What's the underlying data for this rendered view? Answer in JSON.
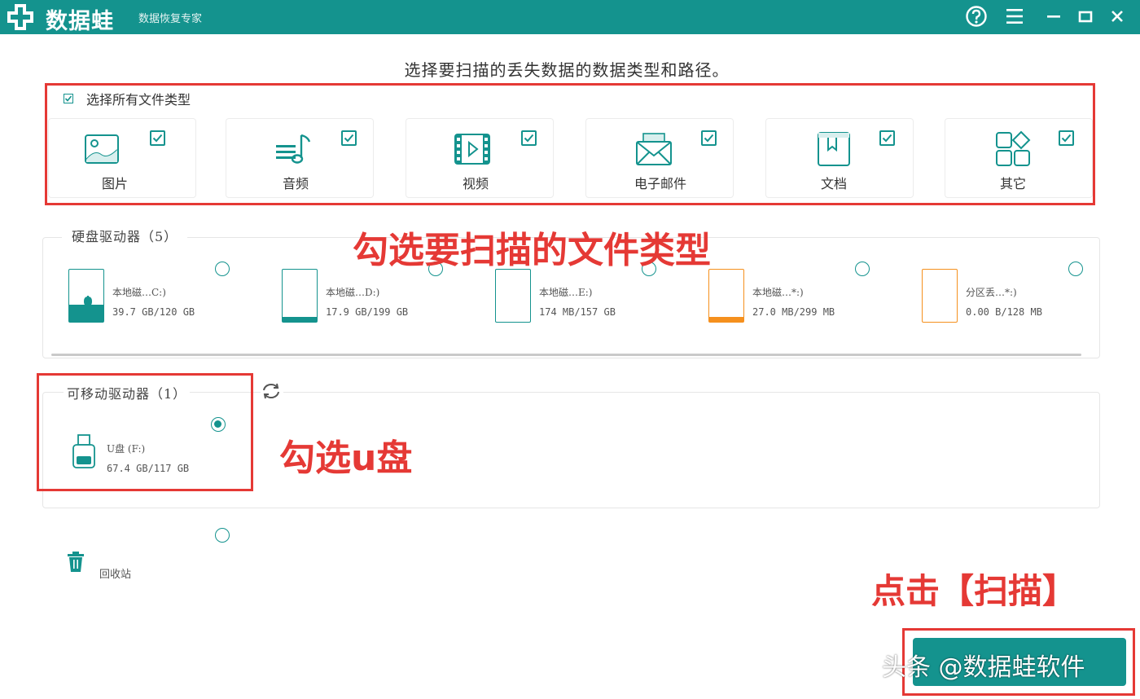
{
  "titlebar": {
    "app_name": "数据蛙",
    "subtitle": "数据恢复专家",
    "background": "#14938e"
  },
  "instruction": "选择要扫描的丢失数据的数据类型和路径。",
  "file_types": {
    "select_all_label": "选择所有文件类型",
    "select_all_checked": true,
    "items": [
      {
        "label": "图片",
        "icon": "image-icon",
        "checked": true
      },
      {
        "label": "音频",
        "icon": "music-icon",
        "checked": true
      },
      {
        "label": "视频",
        "icon": "video-icon",
        "checked": true
      },
      {
        "label": "电子邮件",
        "icon": "email-icon",
        "checked": true
      },
      {
        "label": "文档",
        "icon": "document-icon",
        "checked": true
      },
      {
        "label": "其它",
        "icon": "other-icon",
        "checked": true
      }
    ]
  },
  "hard_drives": {
    "legend": "硬盘驱动器（5）",
    "items": [
      {
        "name": "本地磁…C:)",
        "size": "39.7 GB/120 GB",
        "fill": 0.33,
        "color": "#14938e",
        "system": true
      },
      {
        "name": "本地磁…D:)",
        "size": "17.9 GB/199 GB",
        "fill": 0.09,
        "color": "#14938e"
      },
      {
        "name": "本地磁…E:)",
        "size": "174 MB/157 GB",
        "fill": 0.0,
        "color": "#14938e"
      },
      {
        "name": "本地磁…*:)",
        "size": "27.0 MB/299 MB",
        "fill": 0.09,
        "color": "#f5901e"
      },
      {
        "name": "分区丢…*:)",
        "size": "0.00  B/128 MB",
        "fill": 0.0,
        "color": "#f5901e"
      }
    ]
  },
  "removable": {
    "legend": "可移动驱动器（1）",
    "name": "U盘 (F:)",
    "size": "67.4 GB/117 GB",
    "selected": true
  },
  "recycle_bin": {
    "label": "回收站",
    "selected": false
  },
  "annotations": {
    "file_types_note": "勾选要扫描的文件类型",
    "usb_note": "勾选u盘",
    "scan_note": "点击【扫描】",
    "color": "#e53935"
  },
  "watermark": "头条 @数据蛙软件"
}
